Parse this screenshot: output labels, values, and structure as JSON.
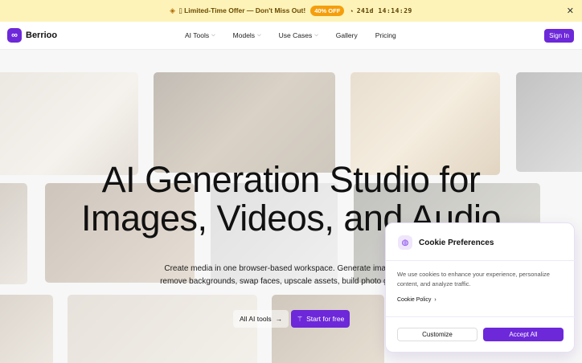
{
  "promo": {
    "icon": "tag-icon",
    "text": "▯ Limited-Time Offer — Don't Miss Out!",
    "badge": "40% OFF",
    "clock_icon": "clock-icon",
    "timer": "241d 14:14:29",
    "close_icon": "close-icon"
  },
  "nav": {
    "logo_text": "Berrioo",
    "logo_icon": "infinity-icon",
    "items": [
      {
        "label": "AI Tools",
        "dropdown": true
      },
      {
        "label": "Models",
        "dropdown": true
      },
      {
        "label": "Use Cases",
        "dropdown": true
      },
      {
        "label": "Gallery",
        "dropdown": false
      },
      {
        "label": "Pricing",
        "dropdown": false
      }
    ],
    "signin_label": "Sign In"
  },
  "hero": {
    "headline_line1": "AI Generation Studio for",
    "headline_line2": "Images, Videos, and Audio",
    "subtitle_line1": "Create media in one browser-based workspace. Generate images and",
    "subtitle_line2": "remove backgrounds, swap faces, upscale assets, build photo grids, and",
    "all_tools_label": "All AI tools",
    "start_label": "Start for free"
  },
  "cookie": {
    "title": "Cookie Preferences",
    "body": "We use cookies to enhance your experience, personalize content, and analyze traffic.",
    "policy_link": "Cookie Policy",
    "customize_label": "Customize",
    "accept_label": "Accept All"
  },
  "colors": {
    "accent": "#6d28d9",
    "promo_bg": "#fdf3b8",
    "badge": "#f59e0b"
  }
}
